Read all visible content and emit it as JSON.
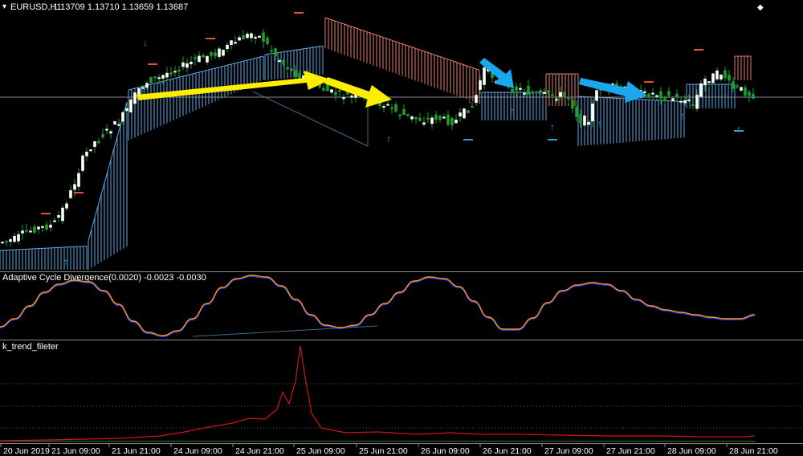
{
  "window": {
    "symbol_label": "EURUSD,H1",
    "ohlc": "1.13709 1.13710 1.13659 1.13687",
    "corner_glyph": "◆"
  },
  "panels": {
    "acd_title": "Adaptive Cycle Divergence(0.0020) -0.0023 -0.0030",
    "trend_title": "k_trend_fileter"
  },
  "colors": {
    "background": "#000000",
    "bull_candle": "#ffffff",
    "bear_candle": "#1f9d2a",
    "cloud_up": "#5aa9e6",
    "cloud_down": "#e08070",
    "arrow_up": "#29a3e6",
    "arrow_down": "#e0553a",
    "yellow_annotation": "#ffee00",
    "blue_annotation": "#1aa7ec",
    "acd_line_a": "#ff9900",
    "acd_line_b": "#2233ff",
    "trend_line": "#d01515",
    "separator": "#8a8a8a"
  },
  "chart_data": [
    {
      "type": "candlestick",
      "title": "EURUSD,H1",
      "x_ticks": [
        "20 Jun 2019",
        "21 Jun 09:00",
        "21 Jun 21:00",
        "24 Jun 09:00",
        "24 Jun 21:00",
        "25 Jun 09:00",
        "25 Jun 21:00",
        "26 Jun 09:00",
        "26 Jun 21:00",
        "27 Jun 09:00",
        "27 Jun 21:00",
        "28 Jun 09:00",
        "28 Jun 21:00"
      ],
      "close_path": [
        1.1268,
        1.1272,
        1.1275,
        1.1276,
        1.1279,
        1.1296,
        1.1318,
        1.1334,
        1.1356,
        1.1372,
        1.1376,
        1.1379,
        1.1382,
        1.1388,
        1.1392,
        1.1397,
        1.1402,
        1.1392,
        1.1374,
        1.1368,
        1.1366,
        1.136,
        1.1356,
        1.1356,
        1.1364,
        1.1366,
        1.1363,
        1.1368,
        1.1368,
        1.1363,
        1.1364,
        1.1362,
        1.1375,
        1.1372,
        1.1368,
        1.1371,
        1.1369
      ],
      "reference_price_line": 1.1369,
      "signal_arrows": {
        "up": 8,
        "down": 3
      }
    },
    {
      "type": "line",
      "title": "Adaptive Cycle Divergence(0.0020) -0.0023 -0.0030",
      "series": [
        {
          "values": [
            -0.002,
            -0.0005,
            0.0015,
            0.0024,
            0.0018,
            -0.001,
            -0.003,
            -0.0012,
            0.0016,
            0.003,
            0.0022,
            -0.0008,
            -0.0018,
            -0.002,
            0.0004,
            0.0024,
            0.0028,
            0.0012,
            -0.0014,
            -0.0024,
            0.0002,
            0.0022,
            0.0026,
            0.0016,
            0.0004,
            -0.0004,
            -0.001,
            -0.0014
          ]
        }
      ]
    },
    {
      "type": "line",
      "title": "k_trend_fileter",
      "series": [
        {
          "values": [
            2,
            2,
            3,
            3,
            4,
            4,
            5,
            6,
            8,
            9,
            9,
            10,
            11,
            12,
            14,
            18,
            20,
            30,
            60,
            100,
            35,
            18,
            12,
            10,
            10,
            8,
            8,
            7,
            6,
            6,
            5,
            5,
            5,
            4,
            4,
            4,
            3,
            3
          ]
        }
      ]
    }
  ]
}
